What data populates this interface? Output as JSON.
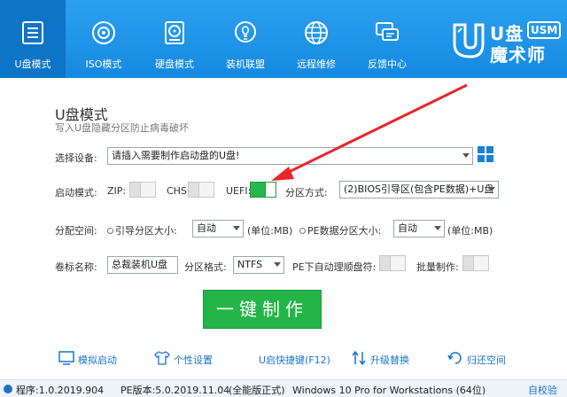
{
  "nav": {
    "items": [
      {
        "label": "U盘模式",
        "icon": "usb-drive-icon",
        "active": true
      },
      {
        "label": "ISO模式",
        "icon": "disc-icon"
      },
      {
        "label": "硬盘模式",
        "icon": "hard-disk-icon"
      },
      {
        "label": "装机联盟",
        "icon": "lightbulb-icon"
      },
      {
        "label": "远程维修",
        "icon": "globe-icon"
      },
      {
        "label": "反馈中心",
        "icon": "chat-icon"
      }
    ]
  },
  "logo": {
    "line1": "U盘",
    "badge": "USM",
    "line2": "魔术师"
  },
  "mode": {
    "title": "U盘模式",
    "subtitle": "写入U盘隐藏分区防止病毒破坏"
  },
  "device": {
    "label": "选择设备:",
    "value": "请插入需要制作启动盘的U盘!"
  },
  "boot": {
    "label": "启动模式:",
    "zip": "ZIP:",
    "chs": "CHS:",
    "uefi": "UEFI:",
    "zip_on": false,
    "chs_on": false,
    "uefi_on": true,
    "partition_label": "分区方式:",
    "partition_value": "(2)BIOS引导区(包含PE数据)+U盘"
  },
  "space": {
    "label": "分配空间:",
    "boot_size_label": "引导分区大小:",
    "boot_size_value": "自动",
    "boot_unit": "(单位:MB)",
    "pe_size_label": "PE数据分区大小:",
    "pe_size_value": "自动",
    "pe_unit": "(单位:MB)"
  },
  "volume": {
    "label": "卷标名称:",
    "value": "总裁装机U盘",
    "format_label": "分区格式:",
    "format_value": "NTFS",
    "auto_sort_label": "PE下自动理顺盘符:",
    "batch_label": "批量制作:"
  },
  "make_button": "一键制作",
  "tools": [
    {
      "label": "模拟启动",
      "icon": "monitor-icon"
    },
    {
      "label": "个性设置",
      "icon": "shirt-icon"
    },
    {
      "label": "U启快捷键(F12)",
      "icon": "hotkey-icon"
    },
    {
      "label": "升级替换",
      "icon": "upgrade-icon"
    },
    {
      "label": "归还空间",
      "icon": "restore-icon"
    }
  ],
  "status": {
    "program": "程序:1.0.2019.904",
    "pe_version": "PE版本:5.0.2019.11.04",
    "edition": "(全能版正式)",
    "os": "Windows 10 Pro for Workstations (64位)",
    "link": "自校验"
  },
  "colors": {
    "header": "#1a8fe3",
    "active_tab": "#0d74c8",
    "green": "#24b448",
    "arrow": "#e8262a",
    "link": "#1a73c8"
  }
}
